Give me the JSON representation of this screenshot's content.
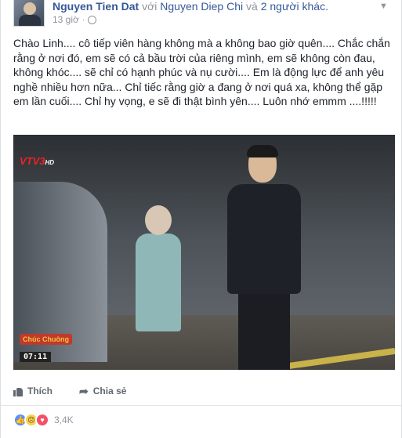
{
  "post": {
    "author": "Nguyen Tien Dat",
    "with_text": "với",
    "tagged": "Nguyen Diep Chi",
    "and_text": "và",
    "others": "2 người khác.",
    "time": "13 giờ",
    "body": "Chào Linh.... cô tiếp viên hàng không mà a không bao giờ quên.... Chắc chắn rằng ở nơi đó, em sẽ có cả bầu trời của riêng mình, em sẽ không còn đau, không khóc.... sẽ chỉ có hạnh phúc và nụ cười.... Em là động lực để anh yêu nghề nhiều hơn nữa... Chỉ tiếc rằng giờ a đang ở nơi quá xa, không thể gặp em lần cuối.... Chỉ hy vọng, e sẽ đi thật bình yên.... Luôn nhớ emmm ....!!!!!"
  },
  "photo": {
    "channel_logo": "VTV3",
    "channel_hd": "HD",
    "program_badge": "Chúc Chuông",
    "timestamp": "07:11"
  },
  "actions": {
    "like": "Thích",
    "share": "Chia sẻ"
  },
  "reactions": {
    "count": "3,4K",
    "icons": [
      "like-icon",
      "sad-icon",
      "love-icon"
    ]
  }
}
